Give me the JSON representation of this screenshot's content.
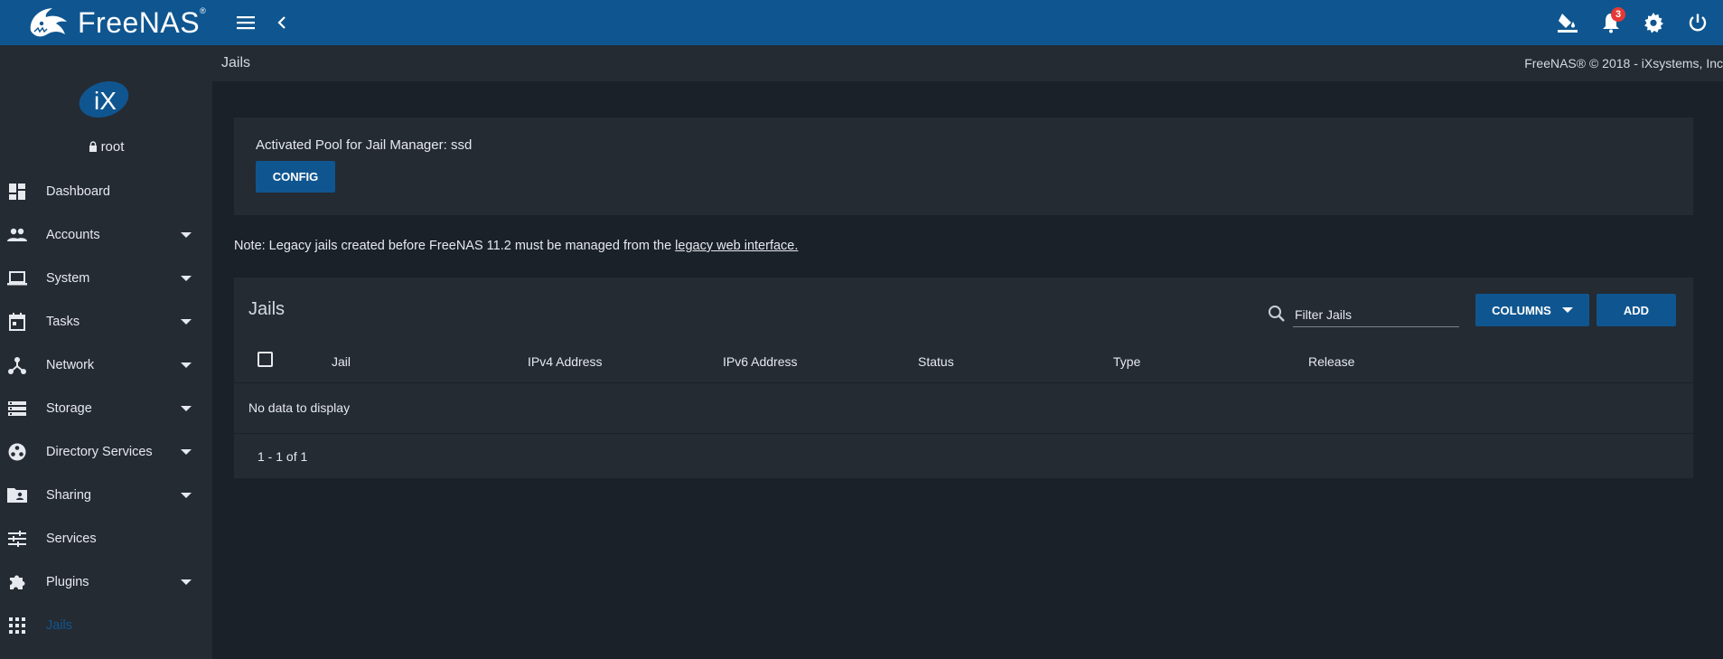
{
  "app": {
    "logo_text": "FreeNAS",
    "logo_mark": "®"
  },
  "topbar": {
    "notification_count": "3"
  },
  "user": {
    "name": "root"
  },
  "sidebar": {
    "items": [
      {
        "label": "Dashboard",
        "icon": "dashboard-icon",
        "has_caret": false
      },
      {
        "label": "Accounts",
        "icon": "people-icon",
        "has_caret": true
      },
      {
        "label": "System",
        "icon": "laptop-icon",
        "has_caret": true
      },
      {
        "label": "Tasks",
        "icon": "calendar-icon",
        "has_caret": true
      },
      {
        "label": "Network",
        "icon": "network-icon",
        "has_caret": true
      },
      {
        "label": "Storage",
        "icon": "storage-icon",
        "has_caret": true
      },
      {
        "label": "Directory Services",
        "icon": "directory-icon",
        "has_caret": true
      },
      {
        "label": "Sharing",
        "icon": "folder-shared-icon",
        "has_caret": true
      },
      {
        "label": "Services",
        "icon": "tune-icon",
        "has_caret": false
      },
      {
        "label": "Plugins",
        "icon": "extension-icon",
        "has_caret": true
      },
      {
        "label": "Jails",
        "icon": "apps-grid-icon",
        "has_caret": false,
        "active": true
      }
    ]
  },
  "breadcrumb": {
    "current": "Jails"
  },
  "copyright": "FreeNAS® © 2018 - iXsystems, Inc",
  "pool_card": {
    "text": "Activated Pool for Jail Manager: ssd",
    "config_label": "CONFIG"
  },
  "note": {
    "prefix": "Note: Legacy jails created before FreeNAS 11.2 must be managed from the ",
    "link": "legacy web interface."
  },
  "jails_table": {
    "title": "Jails",
    "filter_placeholder": "Filter Jails",
    "columns_label": "COLUMNS",
    "add_label": "ADD",
    "headers": [
      "Jail",
      "IPv4 Address",
      "IPv6 Address",
      "Status",
      "Type",
      "Release"
    ],
    "empty_message": "No data to display",
    "pager": "1 - 1 of 1"
  },
  "colors": {
    "topbar": "#0f5690",
    "sidebar": "#252b33",
    "background": "#1b2129",
    "accent": "#0f5690",
    "badge": "#e53935"
  }
}
